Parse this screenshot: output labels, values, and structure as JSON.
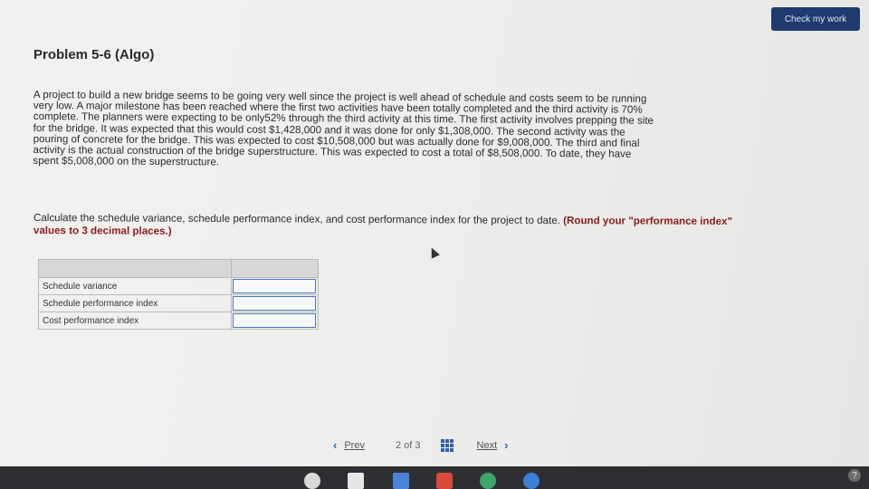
{
  "header": {
    "check_label": "Check my work"
  },
  "problem": {
    "title": "Problem 5-6 (Algo)",
    "lines": [
      "A project to build a new bridge seems to be going very well since the project is well ahead of schedule and costs seem to be running",
      "very low. A major milestone has been reached where the first two activities have been totally completed and the third activity is 70%",
      "complete. The planners were expecting to be only52% through the third activity at this time. The first activity involves prepping the site",
      "for the bridge. It was expected that this would cost $1,428,000 and it was done for only $1,308,000. The second activity was the",
      "pouring of concrete for the bridge. This was expected to cost $10,508,000 but was actually done for $9,008,000. The third and final",
      "activity is the actual construction of the bridge superstructure. This was expected to cost a total of $8,508,000. To date, they have",
      "spent $5,008,000 on the superstructure."
    ],
    "instruction": "Calculate the schedule variance, schedule performance index, and cost performance index for the project to date.",
    "instruction_hint": "(Round your \"performance index\" values to 3 decimal places.)"
  },
  "table": {
    "rows": [
      {
        "label": "Schedule variance",
        "value": ""
      },
      {
        "label": "Schedule performance index",
        "value": ""
      },
      {
        "label": "Cost performance index",
        "value": ""
      }
    ]
  },
  "pager": {
    "prev_label": "Prev",
    "page": "2",
    "of_label": "of",
    "total": "3",
    "next_label": "Next"
  },
  "colors": {
    "button_bg": "#1f3b6d",
    "hint": "#8a1c1c",
    "accent": "#2f5fa8"
  },
  "icons": [
    "chevron-left-icon",
    "grid-icon",
    "chevron-right-icon",
    "help-icon"
  ]
}
